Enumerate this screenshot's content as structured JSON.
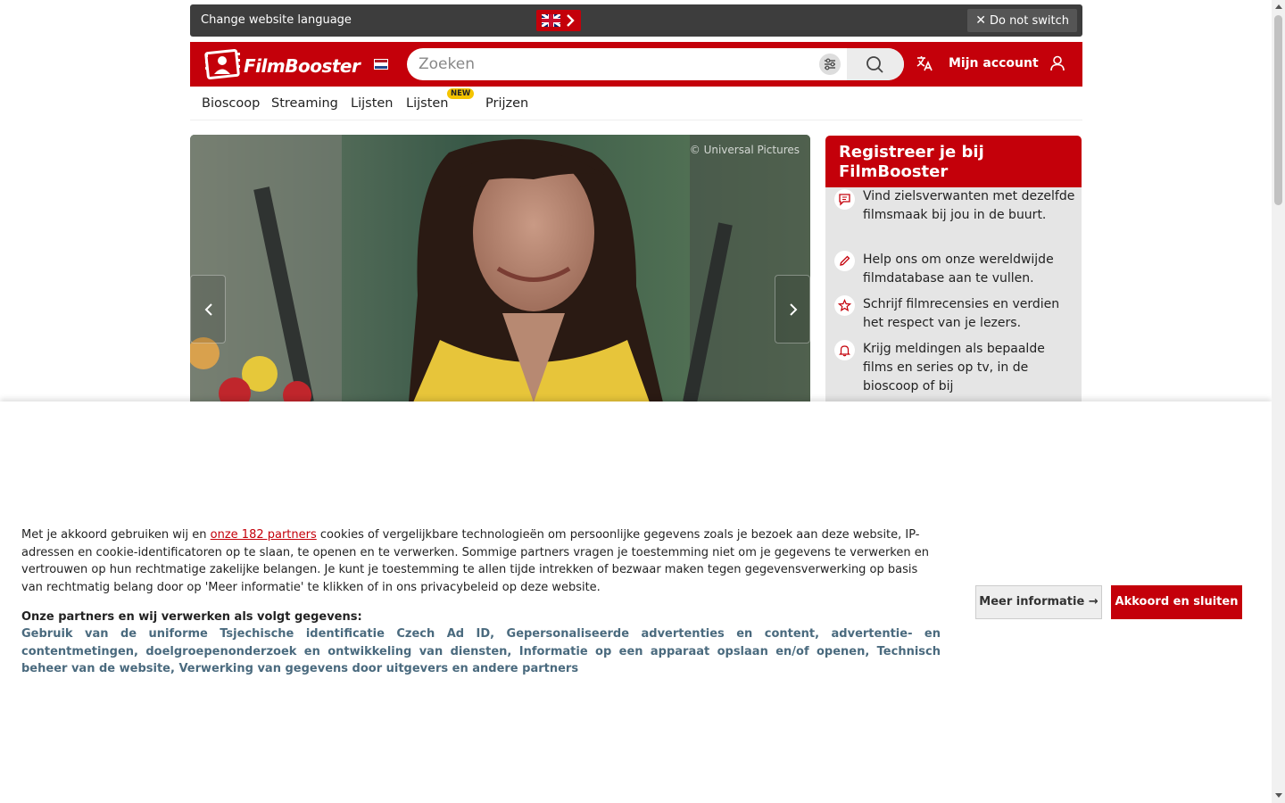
{
  "language_bar": {
    "text": "Change website language",
    "flag_icon": "uk-flag-icon",
    "dismiss_label": "Do not switch"
  },
  "header": {
    "logo_text": "FilmBooster",
    "locale_flag_icon": "netherlands-flag-icon",
    "search_placeholder": "Zoeken",
    "account_label": "Mijn account",
    "brand_color": "#c4000a"
  },
  "nav": {
    "items": [
      "Bioscoop",
      "Streaming",
      "Lijsten",
      "Lijsten",
      "Prijzen"
    ],
    "new_badge": "NEW"
  },
  "hero": {
    "credit": "© Universal Pictures"
  },
  "register": {
    "title": "Registreer je bij FilmBooster",
    "items": [
      {
        "icon": "chat-icon",
        "text": "Vind zielsverwanten met dezelfde filmsmaak bij jou in de buurt."
      },
      {
        "icon": "pencil-icon",
        "text": "Help ons om onze wereldwijde filmdatabase aan te vullen."
      },
      {
        "icon": "star-icon",
        "text": "Schrijf filmrecensies en verdien het respect van je lezers."
      },
      {
        "icon": "bell-icon",
        "text": "Krijg meldingen als bepaalde films en series op tv, in de bioscoop of bij"
      }
    ]
  },
  "consent": {
    "text_before": "Met je akkoord gebruiken wij en ",
    "partners_link": "onze 182 partners",
    "text_after": " cookies of vergelijkbare technologieën om persoonlijke gegevens zoals je bezoek aan deze website, IP-adressen en cookie-identificatoren op te slaan, te openen en te verwerken. Sommige partners vragen je toestemming niet om je gegevens te verwerken en vertrouwen op hun rechtmatige zakelijke belangen. Je kunt je toestemming te allen tijde intrekken of bezwaar maken tegen gegevensverwerking op basis van rechtmatig belang door op 'Meer informatie' te klikken of in ons privacybeleid op deze website.",
    "purposes_heading": "Onze partners en wij verwerken als volgt gegevens:",
    "purposes": "Gebruik van de uniforme Tsjechische identificatie Czech Ad ID, Gepersonaliseerde advertenties en content, advertentie- en contentmetingen, doelgroepenonderzoek en ontwikkeling van diensten, Informatie op een apparaat opslaan en/of openen, Technisch beheer van de website, Verwerking van gegevens door uitgevers en andere partners",
    "more_info_label": "Meer informatie →",
    "accept_label": "Akkoord en sluiten"
  }
}
